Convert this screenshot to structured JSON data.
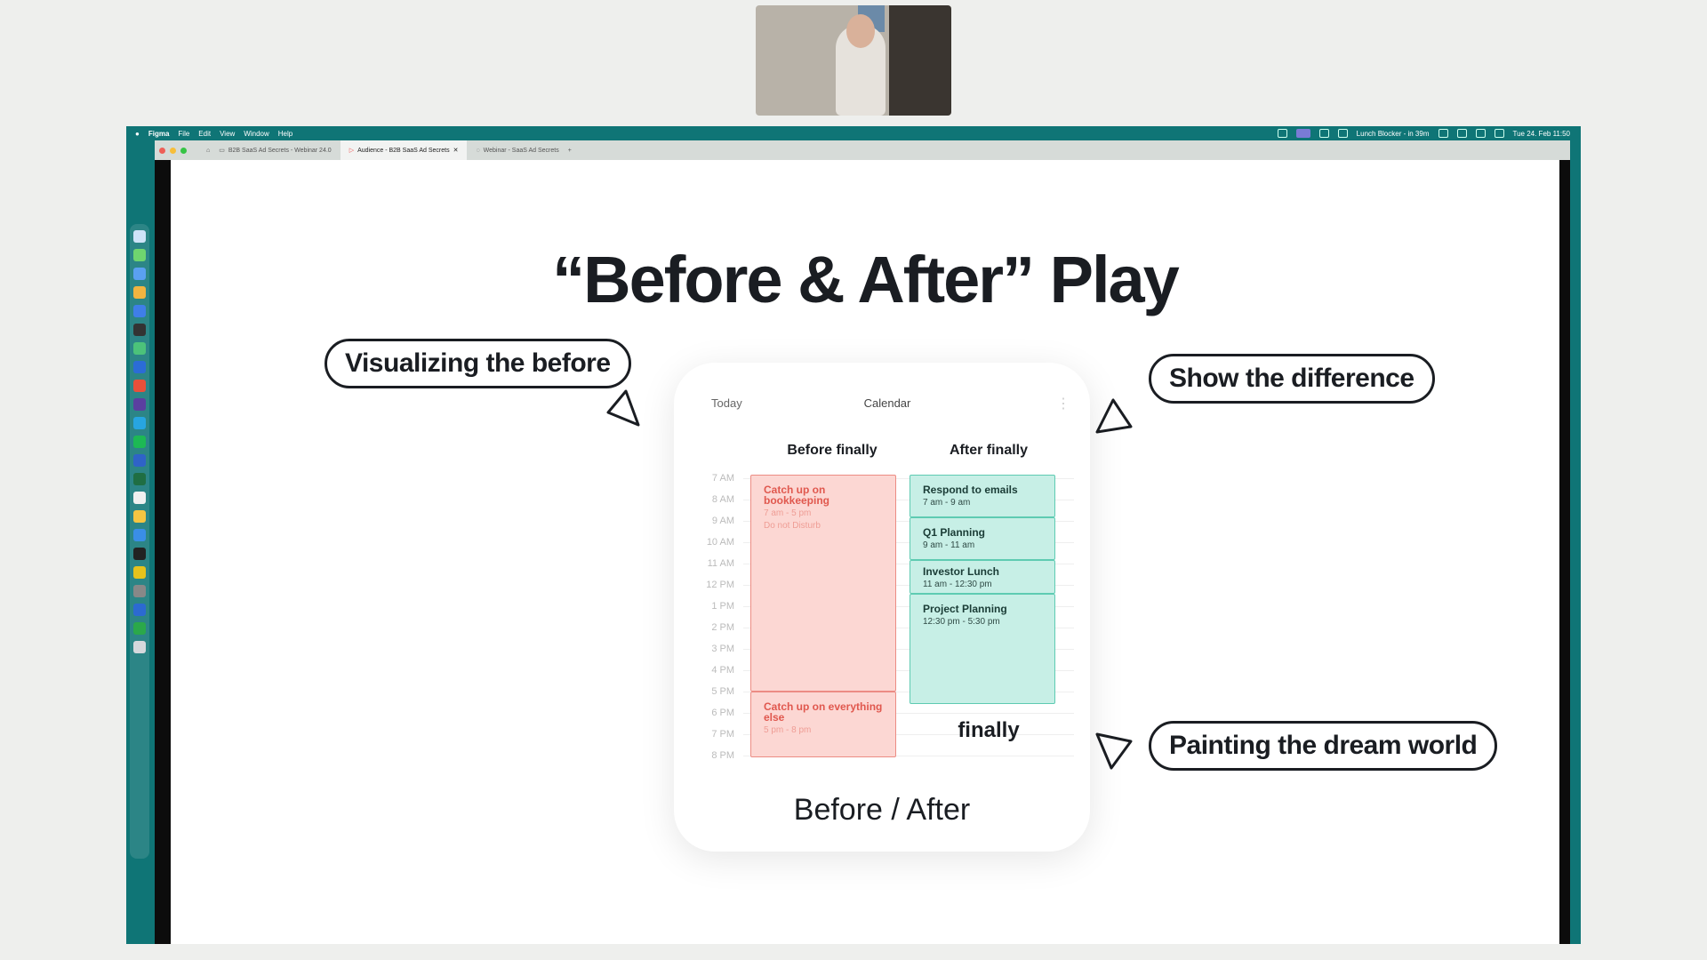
{
  "menubar": {
    "app": "Figma",
    "items": [
      "File",
      "Edit",
      "View",
      "Window",
      "Help"
    ],
    "status_text": "Lunch Blocker - in 39m",
    "clock": "Tue 24. Feb 11:50"
  },
  "browser": {
    "tabs": [
      {
        "label": "B2B SaaS Ad Secrets - Webinar 24.0",
        "active": false
      },
      {
        "label": "Audience - B2B SaaS Ad Secrets",
        "active": true
      },
      {
        "label": "Webinar - SaaS Ad Secrets",
        "active": false
      }
    ],
    "new_tab_symbol": "+"
  },
  "slide": {
    "title": "“Before & After” Play",
    "callouts": {
      "left": "Visualizing the before",
      "top_right": "Show the difference",
      "bottom_right": "Painting the dream world"
    },
    "phone": {
      "today": "Today",
      "calendar": "Calendar",
      "col_before": "Before finally",
      "col_after": "After finally",
      "hours": [
        "7 AM",
        "8 AM",
        "9 AM",
        "10 AM",
        "11 AM",
        "12 PM",
        "1 PM",
        "2 PM",
        "3 PM",
        "4 PM",
        "5 PM",
        "6 PM",
        "7 PM",
        "8 PM"
      ],
      "before_events": [
        {
          "title": "Catch up on bookkeeping",
          "time": "7 am - 5 pm",
          "note": "Do not Disturb"
        },
        {
          "title": "Catch up on everything else",
          "time": "5 pm - 8 pm"
        }
      ],
      "after_events": [
        {
          "title": "Respond to emails",
          "time": "7 am - 9 am"
        },
        {
          "title": "Q1 Planning",
          "time": "9 am - 11 am"
        },
        {
          "title": "Investor Lunch",
          "time": "11 am - 12:30 pm"
        },
        {
          "title": "Project Planning",
          "time": "12:30 pm - 5:30 pm"
        }
      ],
      "finally_label": "finally",
      "footer": "Before / After"
    }
  }
}
